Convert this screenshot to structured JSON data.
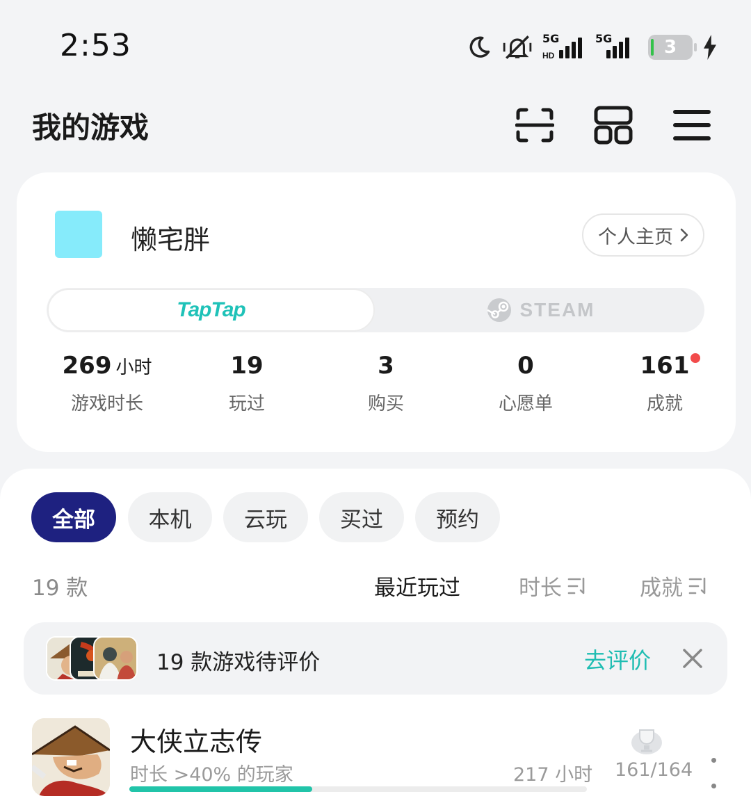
{
  "status_bar": {
    "time": "2:53",
    "network_1": "5G",
    "network_2": "5G",
    "battery": "3"
  },
  "header": {
    "title": "我的游戏",
    "icons": [
      "scan-icon",
      "grid-view-icon",
      "menu-icon"
    ]
  },
  "profile": {
    "username": "懒宅胖",
    "avatar_color": "#86ebfb",
    "profile_link": "个人主页",
    "platforms": [
      "TapTap",
      "STEAM"
    ],
    "active_platform": "TapTap",
    "stats": [
      {
        "value": "269",
        "unit": "小时",
        "label": "游戏时长"
      },
      {
        "value": "19",
        "unit": "",
        "label": "玩过"
      },
      {
        "value": "3",
        "unit": "",
        "label": "购买"
      },
      {
        "value": "0",
        "unit": "",
        "label": "心愿单"
      },
      {
        "value": "161",
        "unit": "",
        "label": "成就",
        "badge": true
      }
    ]
  },
  "filters": {
    "tabs": [
      "全部",
      "本机",
      "云玩",
      "买过",
      "预约"
    ],
    "active": "全部"
  },
  "list_header": {
    "count": "19 款",
    "sort_options": [
      "最近玩过",
      "时长",
      "成就"
    ],
    "active_sort": "最近玩过"
  },
  "review_banner": {
    "text": "19 款游戏待评价",
    "action": "去评价"
  },
  "games": [
    {
      "title": "大侠立志传",
      "subtitle": "时长 >40% 的玩家",
      "hours": "217 小时",
      "achievements": "161/164",
      "progress": 0.4
    }
  ],
  "colors": {
    "accent_teal": "#1fbdb2",
    "active_chip": "#1e2180",
    "progress": "#21c4a9",
    "badge_red": "#f24b4b"
  }
}
